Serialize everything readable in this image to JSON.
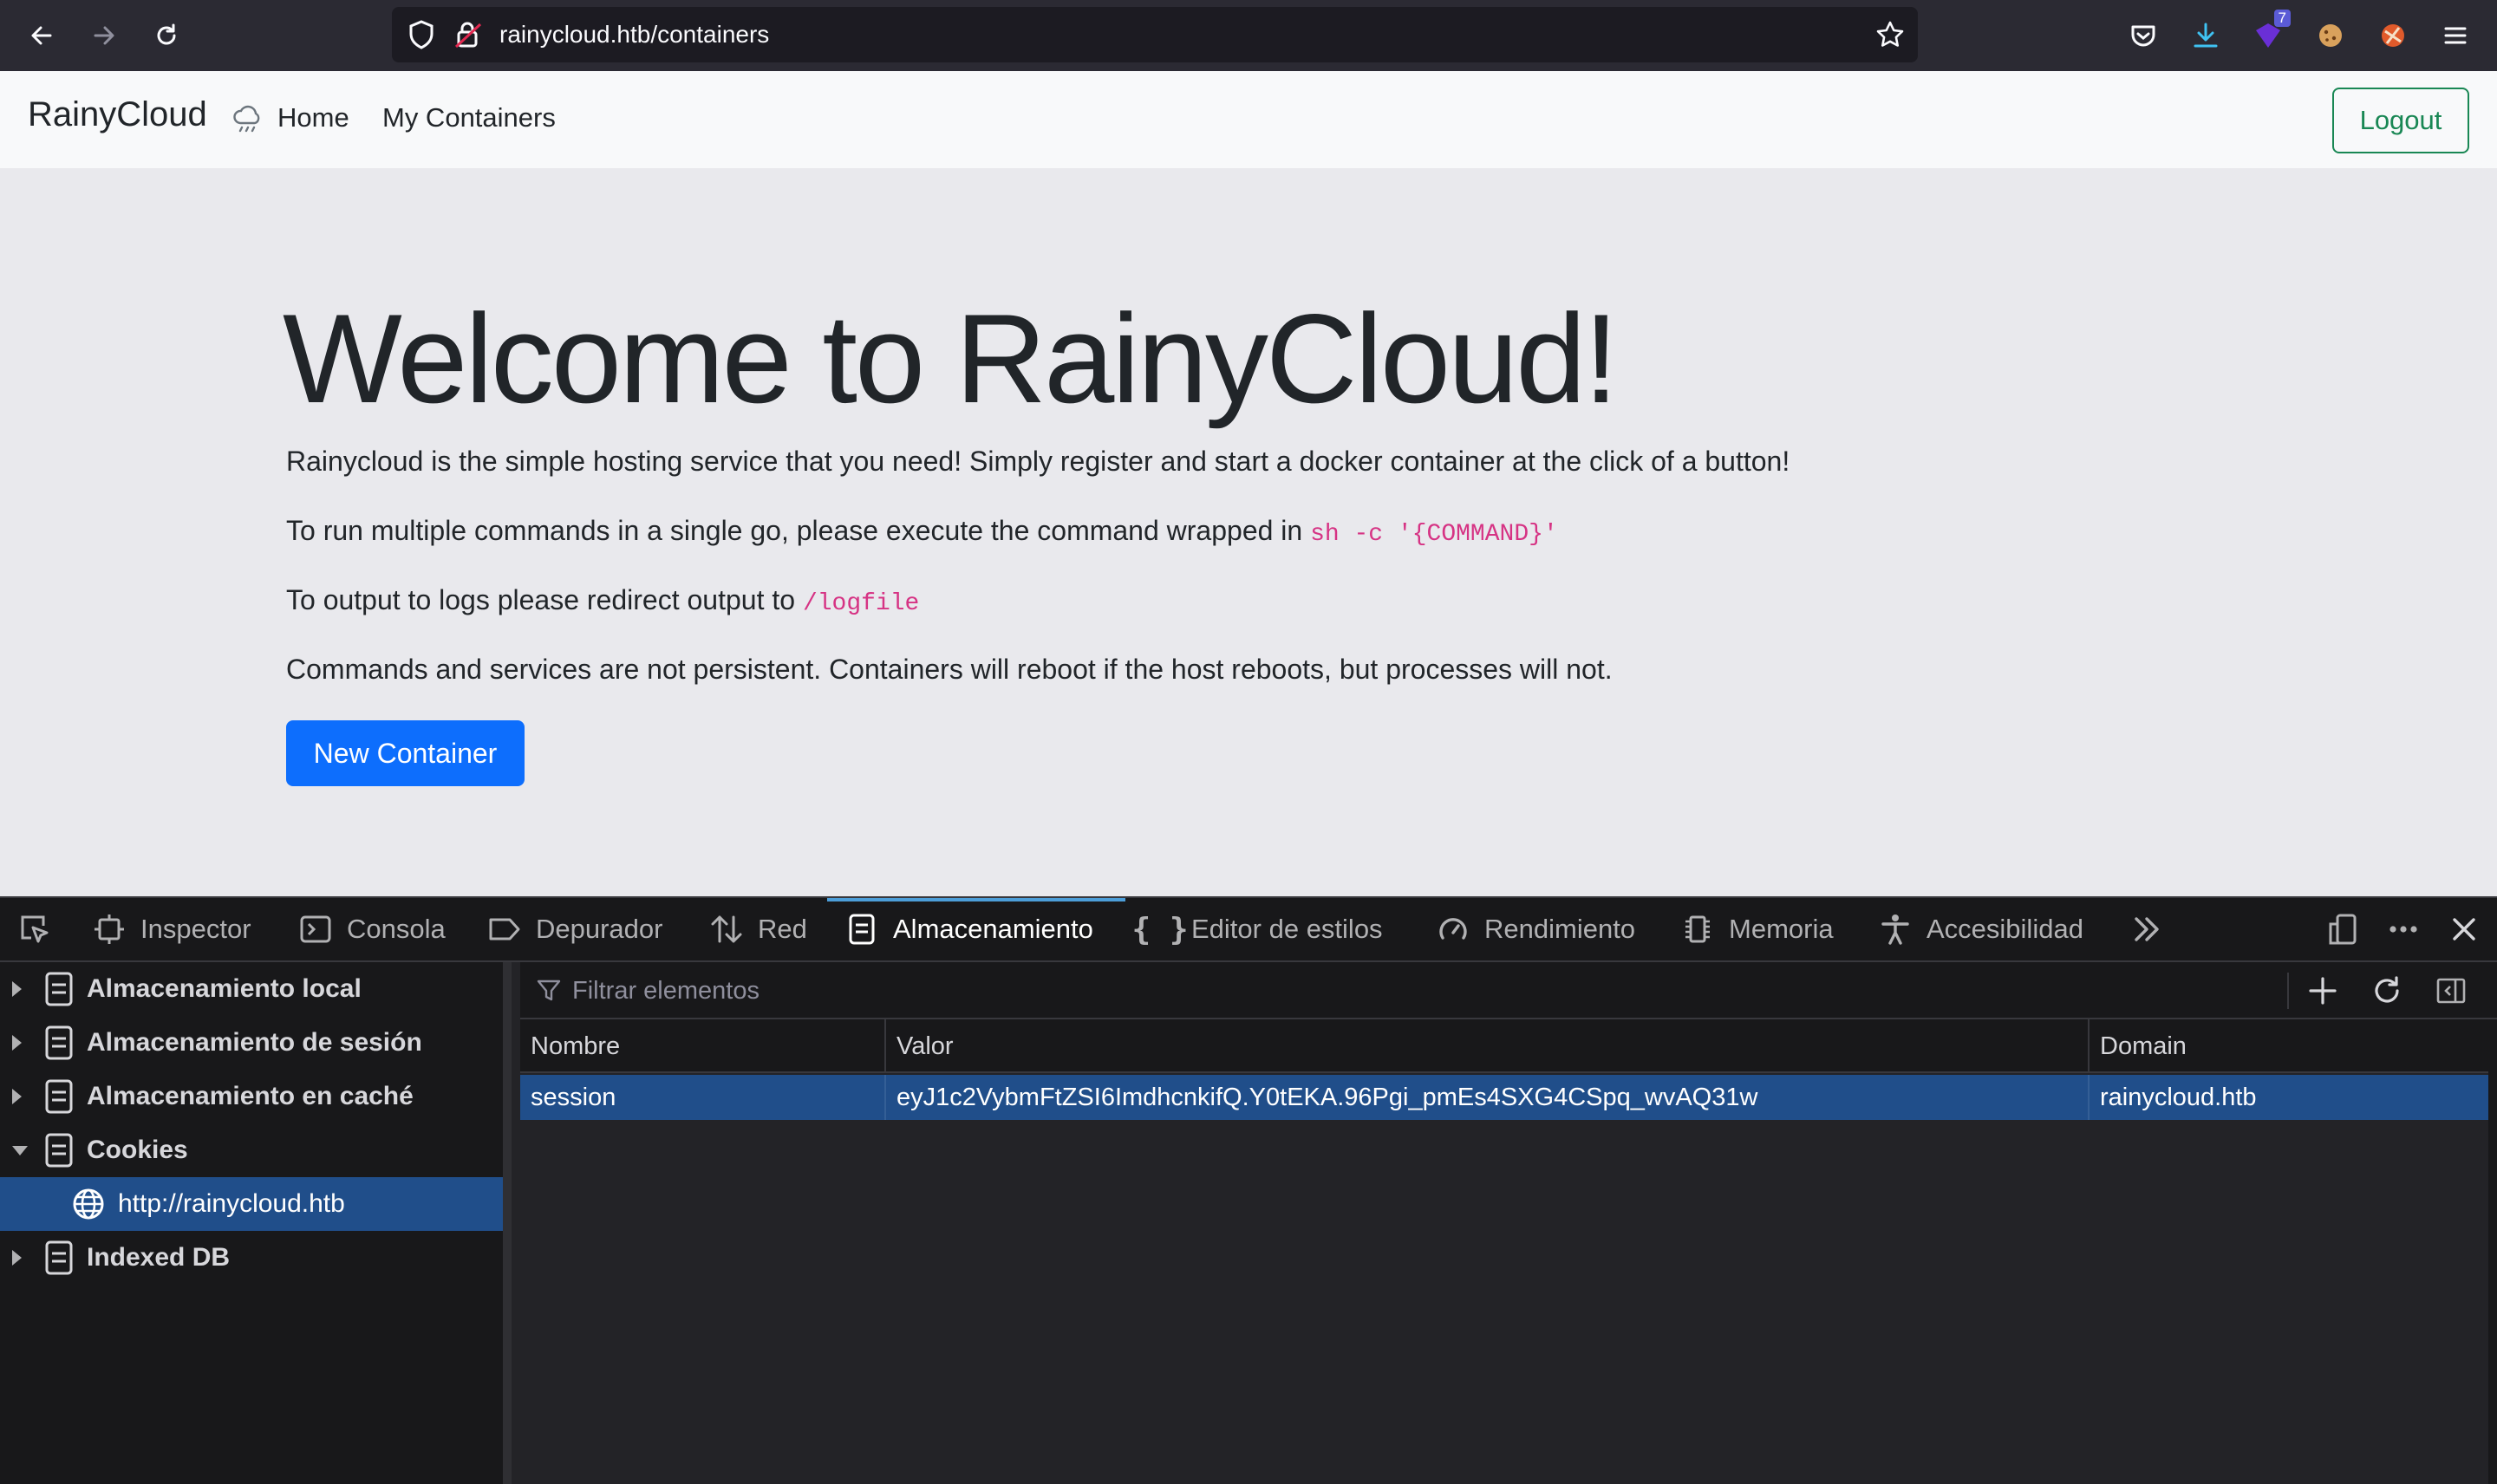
{
  "browser": {
    "url": "rainycloud.htb/containers",
    "extension_badge": "7"
  },
  "navbar": {
    "brand": "RainyCloud",
    "links": [
      "Home",
      "My Containers"
    ],
    "logout_label": "Logout"
  },
  "hero": {
    "title": "Welcome to RainyCloud!",
    "p1": "Rainycloud is the simple hosting service that you need! Simply register and start a docker container at the click of a button!",
    "p2_text": "To run multiple commands in a single go, please execute the command wrapped in ",
    "p2_code": "sh -c '{COMMAND}'",
    "p3_text": "To output to logs please redirect output to ",
    "p3_code": "/logfile",
    "p4": "Commands and services are not persistent. Containers will reboot if the host reboots, but processes will not.",
    "button_label": "New Container"
  },
  "devtools": {
    "tabs": [
      {
        "label": "Inspector",
        "icon": "inspector-icon"
      },
      {
        "label": "Consola",
        "icon": "console-icon"
      },
      {
        "label": "Depurador",
        "icon": "debugger-icon"
      },
      {
        "label": "Red",
        "icon": "network-icon"
      },
      {
        "label": "Almacenamiento",
        "icon": "storage-icon",
        "active": true
      },
      {
        "label": "Editor de estilos",
        "icon": "style-editor-icon"
      },
      {
        "label": "Rendimiento",
        "icon": "performance-icon"
      },
      {
        "label": "Memoria",
        "icon": "memory-icon"
      },
      {
        "label": "Accesibilidad",
        "icon": "accessibility-icon"
      }
    ],
    "sidebar": [
      {
        "label": "Almacenamiento local",
        "expanded": false
      },
      {
        "label": "Almacenamiento de sesión",
        "expanded": false
      },
      {
        "label": "Almacenamiento en caché",
        "expanded": false
      },
      {
        "label": "Cookies",
        "expanded": true
      },
      {
        "label": "http://rainycloud.htb",
        "selected": true
      },
      {
        "label": "Indexed DB",
        "expanded": false
      }
    ],
    "filter_placeholder": "Filtrar elementos",
    "table": {
      "headers": [
        "Nombre",
        "Valor",
        "Domain"
      ],
      "rows": [
        {
          "name": "session",
          "value": "eyJ1c2VybmFtZSI6ImdhcnkifQ.Y0tEKA.96Pgi_pmEs4SXG4CSpq_wvAQ31w",
          "domain": "rainycloud.htb"
        }
      ]
    }
  },
  "colors": {
    "browser_bar": "#2b2a33",
    "page_bg": "#e9e9ed",
    "primary": "#0d6efd",
    "success": "#198754",
    "code": "#d63384",
    "devtools_selected": "#204e8a",
    "devtools_active_tab": "#4c9ed9"
  }
}
